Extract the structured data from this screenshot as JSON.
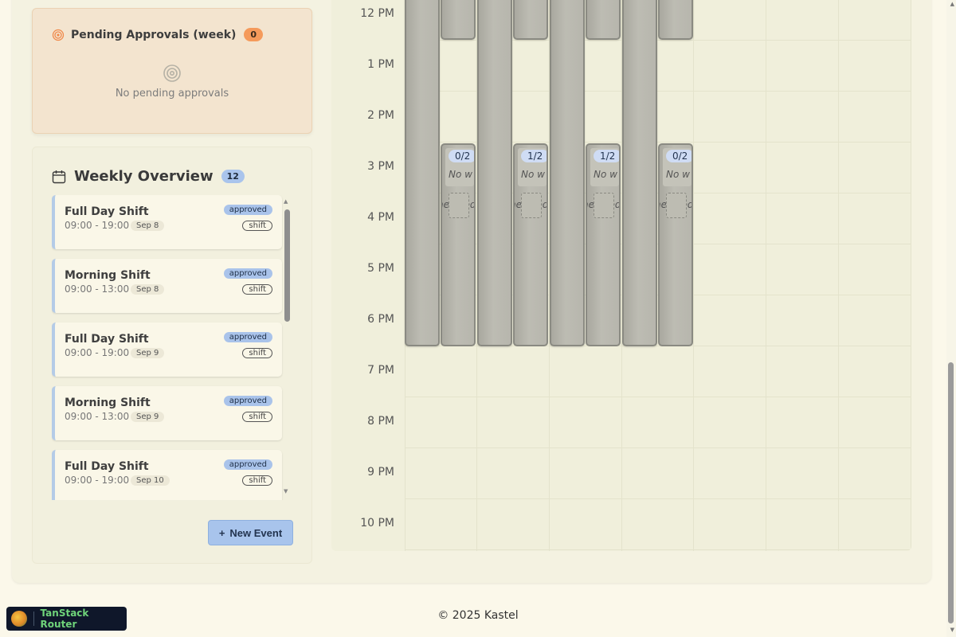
{
  "pending": {
    "title": "Pending Approvals (week)",
    "count": "0",
    "empty_text": "No pending approvals",
    "icon": "target-icon"
  },
  "weekly": {
    "title": "Weekly Overview",
    "count": "12",
    "icon": "calendar-icon",
    "events": [
      {
        "title": "Full Day Shift",
        "time": "09:00 - 19:00",
        "date": "Sep 8",
        "status": "approved",
        "type": "shift"
      },
      {
        "title": "Morning Shift",
        "time": "09:00 - 13:00",
        "date": "Sep 8",
        "status": "approved",
        "type": "shift"
      },
      {
        "title": "Full Day Shift",
        "time": "09:00 - 19:00",
        "date": "Sep 9",
        "status": "approved",
        "type": "shift"
      },
      {
        "title": "Morning Shift",
        "time": "09:00 - 13:00",
        "date": "Sep 9",
        "status": "approved",
        "type": "shift"
      },
      {
        "title": "Full Day Shift",
        "time": "09:00 - 19:00",
        "date": "Sep 10",
        "status": "approved",
        "type": "shift"
      }
    ],
    "new_event_label": "New Event",
    "new_event_icon": "plus-icon"
  },
  "calendar": {
    "times": [
      "12 PM",
      "1 PM",
      "2 PM",
      "3 PM",
      "4 PM",
      "5 PM",
      "6 PM",
      "7 PM",
      "8 PM",
      "9 PM",
      "10 PM"
    ],
    "slots": [
      {
        "count": "0/2",
        "note": "No w",
        "note2": "heduled"
      },
      {
        "count": "1/2",
        "note": "No w",
        "note2": "heduled"
      },
      {
        "count": "1/2",
        "note": "No w",
        "note2": "heduled"
      },
      {
        "count": "0/2",
        "note": "No w",
        "note2": "heduled"
      }
    ]
  },
  "footer": {
    "copyright": "© 2025 Kastel"
  },
  "devtools": {
    "label": "TanStack Router"
  },
  "colors": {
    "accent_blue": "#a9c4ec",
    "pending_orange": "#f59a5b",
    "background": "#fbf8ea"
  }
}
